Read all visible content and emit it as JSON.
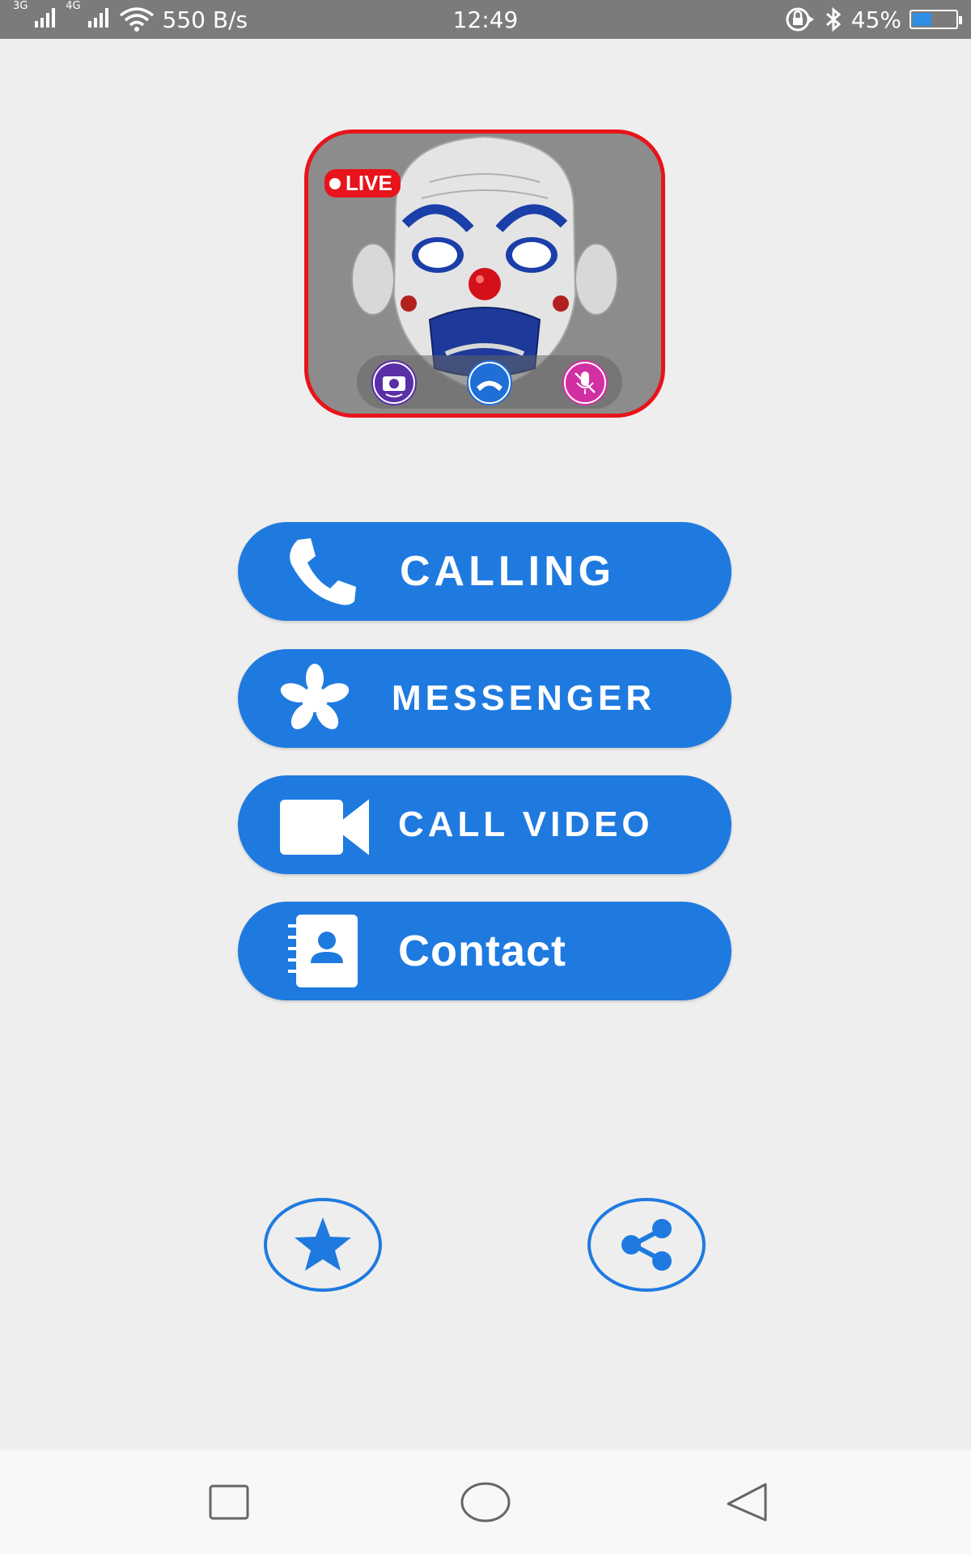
{
  "status_bar": {
    "network_1": "3G",
    "network_2": "4G",
    "speed": "550 B/s",
    "time": "12:49",
    "battery": "45%",
    "battery_level": 0.45
  },
  "hero": {
    "live_label": "LIVE",
    "image_description": "clown-mask-video-call",
    "controls": [
      "switch-camera-icon",
      "end-call-icon",
      "mute-mic-icon"
    ]
  },
  "menu": {
    "calling": "CALLING",
    "messenger": "MESSENGER",
    "call_video": "CALL VIDEO",
    "contact": "Contact"
  },
  "actions": {
    "rate_icon": "star-icon",
    "share_icon": "share-icon"
  },
  "nav": {
    "recents_icon": "square-icon",
    "home_icon": "circle-icon",
    "back_icon": "triangle-back-icon"
  },
  "colors": {
    "accent": "#1f7ae0",
    "status_bar": "#7b7b7b",
    "live_red": "#e8141b",
    "background": "#eeeeee"
  }
}
